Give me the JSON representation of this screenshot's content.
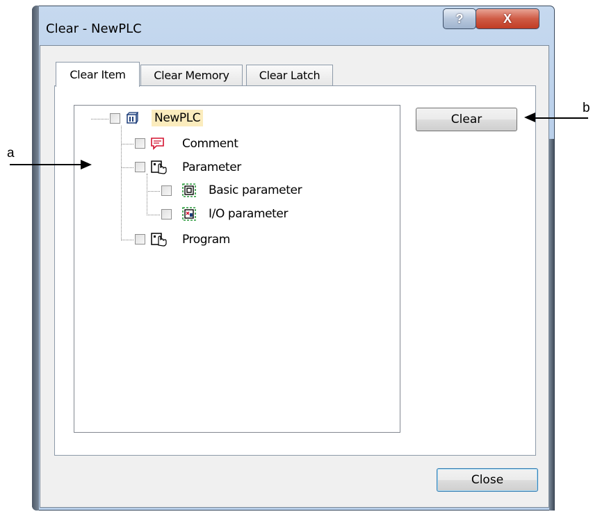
{
  "window": {
    "title": "Clear - NewPLC",
    "help_glyph": "?",
    "close_glyph": "X"
  },
  "tabs": [
    {
      "label": "Clear Item",
      "active": true
    },
    {
      "label": "Clear Memory",
      "active": false
    },
    {
      "label": "Clear Latch",
      "active": false
    }
  ],
  "tree": {
    "root": {
      "label": "NewPLC",
      "icon": "plc-icon",
      "checked": false
    },
    "items": [
      {
        "label": "Comment",
        "icon": "comment-icon",
        "checked": false
      },
      {
        "label": "Parameter",
        "icon": "parameter-icon",
        "checked": false
      },
      {
        "label": "Basic parameter",
        "icon": "basic-parameter-icon",
        "checked": false
      },
      {
        "label": "I/O parameter",
        "icon": "io-parameter-icon",
        "checked": false
      },
      {
        "label": "Program",
        "icon": "program-icon",
        "checked": false
      }
    ]
  },
  "buttons": {
    "clear": "Clear",
    "close": "Close"
  },
  "callouts": {
    "a": "a",
    "b": "b"
  },
  "colors": {
    "selection": "#fbecbd",
    "close_button": "#c13c24",
    "frame": "#a9c3e4"
  }
}
